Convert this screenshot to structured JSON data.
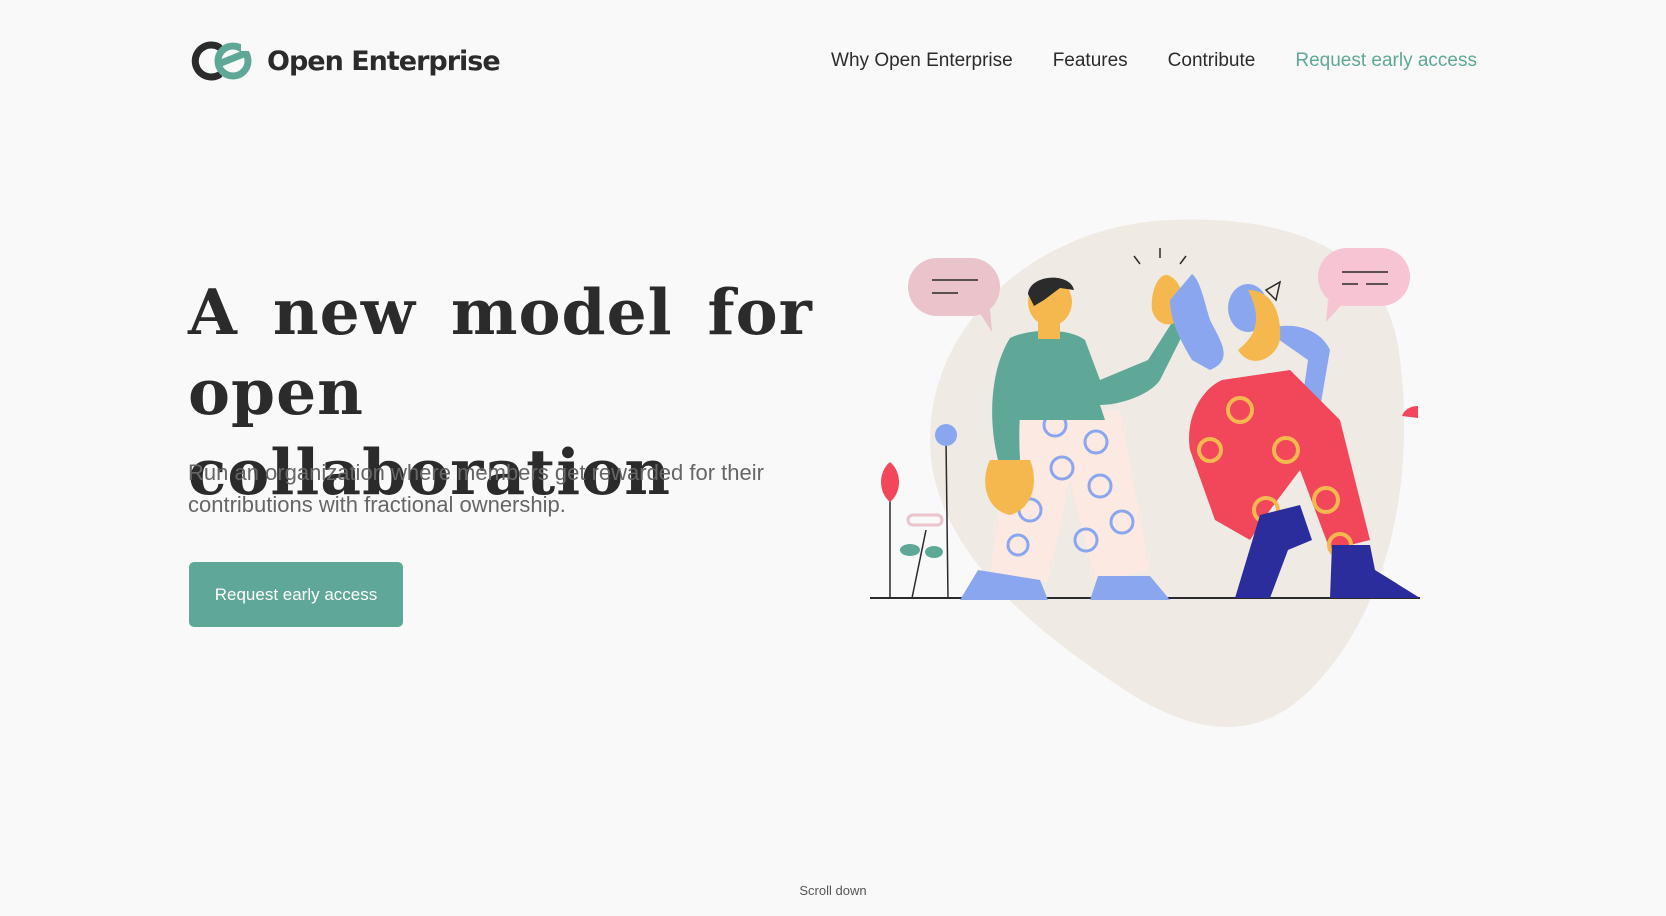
{
  "brand": {
    "name": "Open Enterprise",
    "accent_color": "#5fa897",
    "dark_color": "#2b2b2b"
  },
  "nav": {
    "items": [
      {
        "label": "Why Open Enterprise"
      },
      {
        "label": "Features"
      },
      {
        "label": "Contribute"
      },
      {
        "label": "Request early access"
      }
    ]
  },
  "hero": {
    "title_line1": "A new model for",
    "title_line2": "open collaboration",
    "subtitle": "Run an organization where members get rewarded for their contributions with fractional ownership.",
    "cta_label": "Request early access"
  },
  "illustration": {
    "icon": "high-five-illustration",
    "colors": {
      "blob": "#efebe4",
      "green": "#5fa897",
      "blue": "#8aa6ee",
      "pink_bubble": "#eac3cb",
      "pink_bubble_right": "#f7c4d4",
      "red_pants": "#f2465a",
      "navy": "#2c2d9c",
      "skin": "#f5b84e"
    }
  },
  "footer": {
    "scroll_label": "Scroll down"
  }
}
